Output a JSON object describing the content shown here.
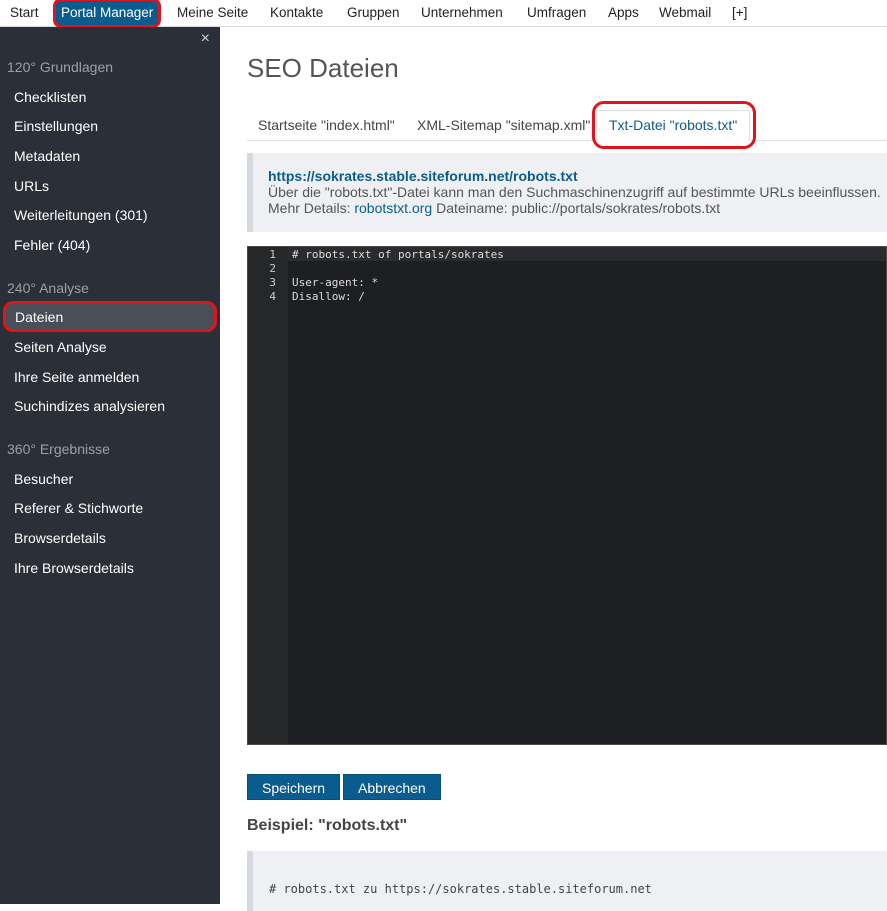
{
  "topnav": {
    "items": [
      {
        "label": "Start"
      },
      {
        "label": "Portal Manager"
      },
      {
        "label": "Meine Seite"
      },
      {
        "label": "Kontakte"
      },
      {
        "label": "Gruppen"
      },
      {
        "label": "Unternehmen"
      },
      {
        "label": "Umfragen"
      },
      {
        "label": "Apps"
      },
      {
        "label": "Webmail"
      },
      {
        "label": "[+]"
      }
    ],
    "active": "Portal Manager"
  },
  "sidebar": {
    "close_icon": "×",
    "sections": [
      {
        "heading": "120° Grundlagen",
        "items": [
          "Checklisten",
          "Einstellungen",
          "Metadaten",
          "URLs",
          "Weiterleitungen (301)",
          "Fehler (404)"
        ]
      },
      {
        "heading": "240° Analyse",
        "items": [
          "Dateien",
          "Seiten Analyse",
          "Ihre Seite anmelden",
          "Suchindizes analysieren"
        ]
      },
      {
        "heading": "360° Ergebnisse",
        "items": [
          "Besucher",
          "Referer & Stichworte",
          "Browserdetails",
          "Ihre Browserdetails"
        ]
      }
    ],
    "active_item": "Dateien"
  },
  "main": {
    "title": "SEO Dateien",
    "tabs": [
      {
        "label": "Startseite \"index.html\""
      },
      {
        "label": "XML-Sitemap \"sitemap.xml\""
      },
      {
        "label": "Txt-Datei \"robots.txt\""
      }
    ],
    "info": {
      "url": "https://sokrates.stable.siteforum.net/robots.txt",
      "description": "Über die \"robots.txt\"-Datei kann man den Suchmaschinenzugriff auf bestimmte URLs beeinflussen.",
      "details_prefix": "Mehr Details:",
      "details_link": "robotstxt.org",
      "filename_text": "Dateiname: public://portals/sokrates/robots.txt"
    },
    "editor": {
      "lines": [
        "# robots.txt of portals/sokrates",
        "",
        "User-agent: *",
        "Disallow: /"
      ],
      "line_numbers": [
        "1",
        "2",
        "3",
        "4"
      ]
    },
    "buttons": {
      "save": "Speichern",
      "cancel": "Abbrechen"
    },
    "example": {
      "title": "Beispiel: \"robots.txt\"",
      "first_line": "# robots.txt zu https://sokrates.stable.siteforum.net"
    }
  },
  "colors": {
    "accent": "#0b5c8e",
    "sidebar_bg": "#2b2f37",
    "highlight": "#e0141d"
  }
}
